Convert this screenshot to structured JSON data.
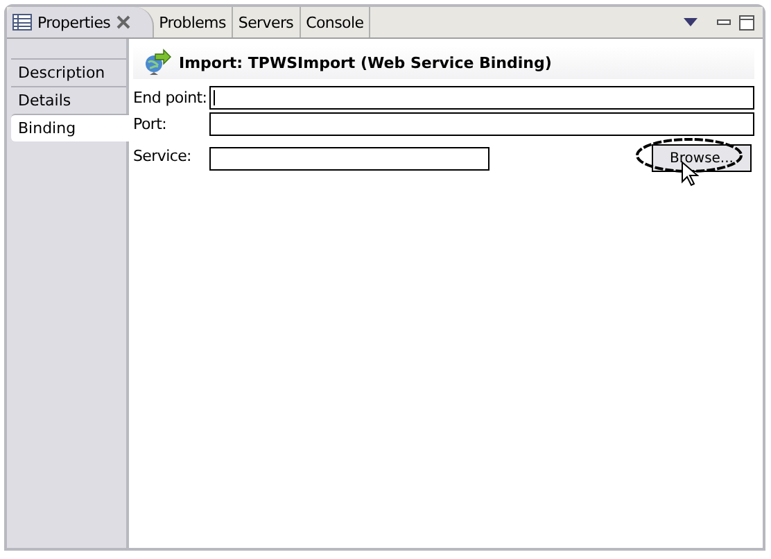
{
  "tabs": [
    {
      "label": "Properties",
      "selected": true,
      "closable": true
    },
    {
      "label": "Problems",
      "selected": false,
      "closable": false
    },
    {
      "label": "Servers",
      "selected": false,
      "closable": false
    },
    {
      "label": "Console",
      "selected": false,
      "closable": false
    }
  ],
  "sidebar": {
    "items": [
      {
        "label": "Description",
        "selected": false
      },
      {
        "label": "Details",
        "selected": false
      },
      {
        "label": "Binding",
        "selected": true
      }
    ]
  },
  "header": {
    "title": "Import: TPWSImport (Web Service Binding)"
  },
  "fields": [
    {
      "label": "End point:",
      "focused": true,
      "wide": true
    },
    {
      "label": "Port:",
      "focused": false,
      "wide": true
    },
    {
      "label": "Service:",
      "focused": false,
      "wide": false
    }
  ],
  "browse_button": {
    "label": "Browse...",
    "highlighted": true
  }
}
